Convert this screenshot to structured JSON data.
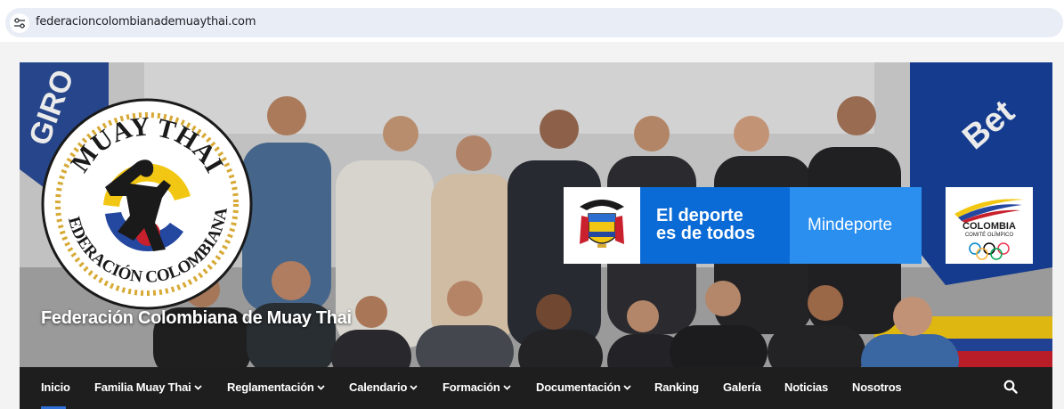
{
  "browser": {
    "url": "federacioncolombianademuaythai.com",
    "site_info_icon": "tune-icon"
  },
  "hero": {
    "site_title": "Federación Colombiana de Muay Thai",
    "seal": {
      "top_text": "MUAY THAI",
      "bottom_text": "FEDERACIÓN COLOMBIANA"
    },
    "ministry_banner": {
      "slogan_line1": "El deporte",
      "slogan_line2": "es de todos",
      "name": "Mindeporte"
    },
    "olympic_logo": {
      "title": "COLOMBIA",
      "subtitle": "COMITÉ OLÍMPICO"
    },
    "background_banners": {
      "left": "GIRO",
      "right": "Bet"
    }
  },
  "nav": {
    "items": [
      {
        "label": "Inicio",
        "dropdown": false,
        "active": true
      },
      {
        "label": "Familia Muay Thai",
        "dropdown": true
      },
      {
        "label": "Reglamentación",
        "dropdown": true
      },
      {
        "label": "Calendario",
        "dropdown": true
      },
      {
        "label": "Formación",
        "dropdown": true
      },
      {
        "label": "Documentación",
        "dropdown": true
      },
      {
        "label": "Ranking",
        "dropdown": false
      },
      {
        "label": "Galería",
        "dropdown": false
      },
      {
        "label": "Noticias",
        "dropdown": false
      },
      {
        "label": "Nosotros",
        "dropdown": false
      }
    ],
    "search_icon": "search-icon"
  },
  "colors": {
    "nav_background": "#1e1e1e",
    "active_indicator": "#2f6fd6",
    "ministry_blue": "#0b6bd6",
    "ministry_light_blue": "#2b8ff0",
    "page_background": "#f3f3f3"
  }
}
